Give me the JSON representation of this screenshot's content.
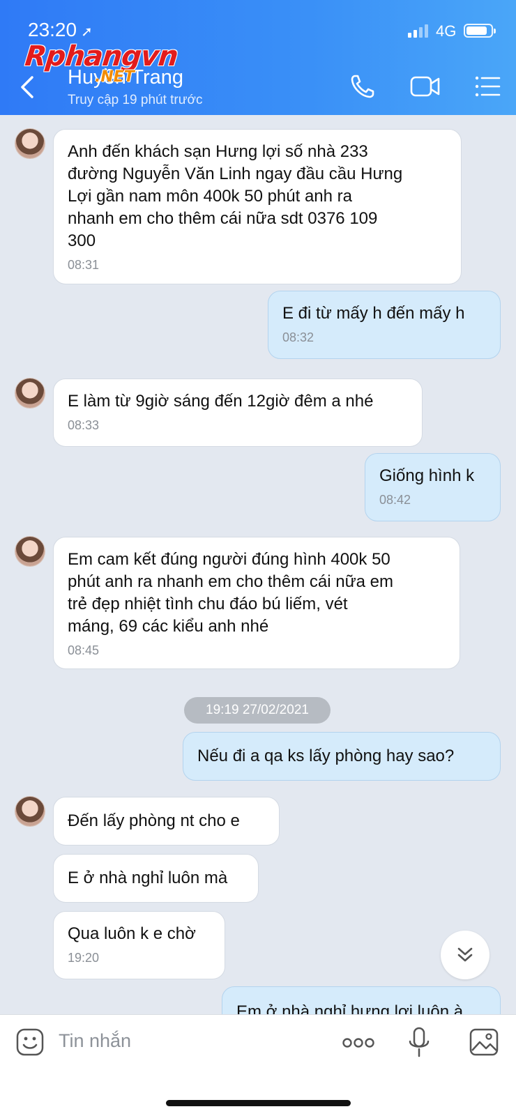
{
  "status_bar": {
    "time": "23:20",
    "network": "4G",
    "battery_fraction": 0.85
  },
  "watermark": {
    "brand": "Rphangvn",
    "suffix": ".NET"
  },
  "header": {
    "contact_name": "Huyền Trang",
    "last_seen": "Truy cập 19 phút trước"
  },
  "messages": [
    {
      "dir": "in",
      "text": "Anh đến khách sạn Hưng lợi số nhà 233\nđường Nguyễn Văn Linh ngay đầu cầu Hưng\nLợi gần nam môn 400k 50 phút anh ra\nnhanh em cho thêm cái nữa sdt 0376 109\n300",
      "time": "08:31"
    },
    {
      "dir": "out",
      "text": "E đi từ mấy h đến mấy h",
      "time": "08:32"
    },
    {
      "dir": "in",
      "text": "E làm từ 9giờ sáng đến 12giờ đêm a nhé",
      "time": "08:33"
    },
    {
      "dir": "out",
      "text": "Giống hình k",
      "time": "08:42"
    },
    {
      "dir": "in",
      "text": "Em cam kết đúng người đúng hình 400k 50\nphút anh ra  nhanh em cho thêm cái nữa em\ntrẻ đẹp nhiệt tình chu đáo bú liếm, vét\nmáng, 69 các kiểu anh nhé",
      "time": "08:45"
    },
    {
      "dir": "out",
      "text": "Nếu đi a qa ks lấy phòng hay sao?",
      "time": ""
    },
    {
      "dir": "in",
      "text": "Đến lấy phòng nt cho e",
      "time": ""
    },
    {
      "dir": "in",
      "text": "E ở nhà nghỉ luôn mà",
      "time": ""
    },
    {
      "dir": "in",
      "text": "Qua luôn k e chờ",
      "time": "19:20"
    },
    {
      "dir": "out",
      "text": "Em ở nhà nghỉ hưng lợi luôn à",
      "time": ""
    }
  ],
  "date_separator": "19:19 27/02/2021",
  "input": {
    "placeholder": "Tin nhắn"
  },
  "icons": [
    "back-icon",
    "phone-icon",
    "video-call-icon",
    "menu-icon",
    "chevron-double-down-icon",
    "emoji-icon",
    "more-icon",
    "microphone-icon",
    "gallery-icon"
  ]
}
